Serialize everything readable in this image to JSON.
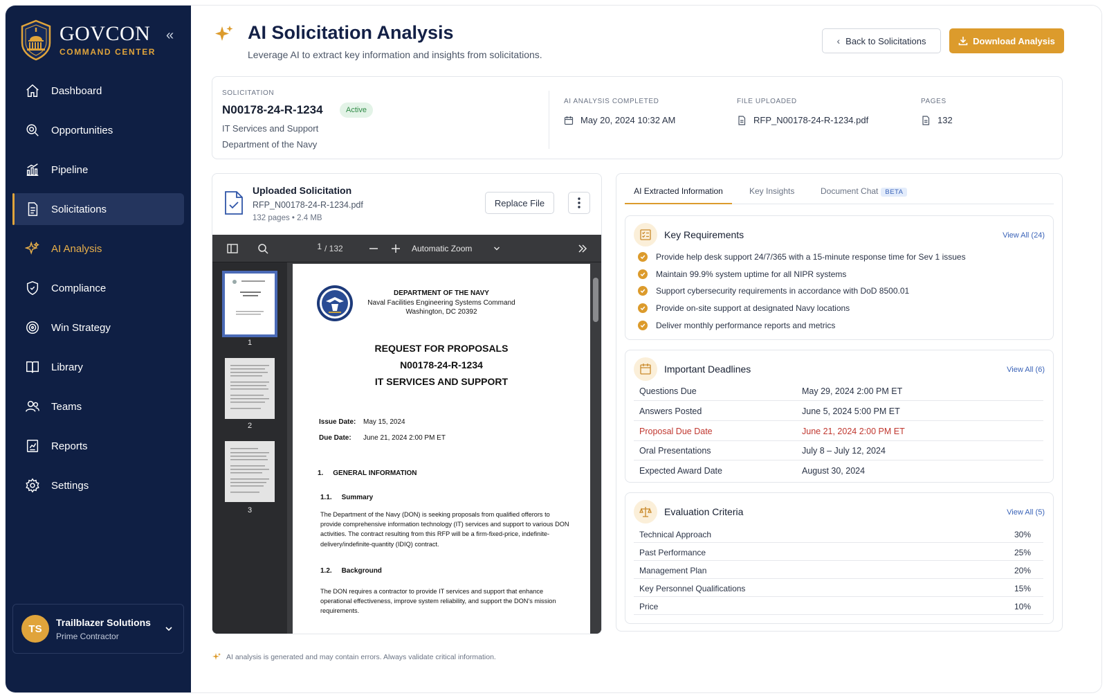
{
  "brand": {
    "name": "GOVCON",
    "tagline": "COMMAND CENTER"
  },
  "sidebar": {
    "items": [
      {
        "label": "Dashboard",
        "icon": "home-icon"
      },
      {
        "label": "Opportunities",
        "icon": "target-search-icon"
      },
      {
        "label": "Pipeline",
        "icon": "bar-chart-icon"
      },
      {
        "label": "Solicitations",
        "icon": "document-icon",
        "active": true
      },
      {
        "label": "AI Analysis",
        "icon": "sparkle-icon",
        "accent": true
      },
      {
        "label": "Compliance",
        "icon": "shield-icon"
      },
      {
        "label": "Win Strategy",
        "icon": "bullseye-icon"
      },
      {
        "label": "Library",
        "icon": "book-icon"
      },
      {
        "label": "Teams",
        "icon": "users-icon"
      },
      {
        "label": "Reports",
        "icon": "report-icon"
      },
      {
        "label": "Settings",
        "icon": "gear-icon"
      }
    ],
    "user": {
      "initials": "TS",
      "name": "Trailblazer Solutions",
      "role": "Prime Contractor"
    }
  },
  "header": {
    "title": "AI Solicitation Analysis",
    "subtitle": "Leverage AI to extract key information and insights from solicitations.",
    "back_label": "Back to Solicitations",
    "download_label": "Download Analysis"
  },
  "solicitation": {
    "label": "SOLICITATION",
    "number": "N00178-24-R-1234",
    "status": "Active",
    "title": "IT Services and Support",
    "agency": "Department of the Navy",
    "meta": [
      {
        "label": "AI ANALYSIS COMPLETED",
        "value": "May 20, 2024 10:32 AM",
        "icon": "calendar-icon"
      },
      {
        "label": "FILE UPLOADED",
        "value": "RFP_N00178-24-R-1234.pdf",
        "icon": "file-icon"
      },
      {
        "label": "PAGES",
        "value": "132",
        "icon": "file-icon"
      }
    ]
  },
  "upload": {
    "title": "Uploaded Solicitation",
    "filename": "RFP_N00178-24-R-1234.pdf",
    "meta": "132 pages • 2.4 MB",
    "replace_label": "Replace File"
  },
  "viewer": {
    "page": "1",
    "total": "/ 132",
    "zoom": "Automatic Zoom",
    "thumbs": [
      "1",
      "2",
      "3"
    ],
    "doc": {
      "dept": "DEPARTMENT OF THE NAVY",
      "command": "Naval Facilities Engineering Systems Command",
      "location": "Washington, DC 20392",
      "title1": "REQUEST FOR PROPOSALS",
      "title2": "N00178-24-R-1234",
      "title3": "IT SERVICES AND SUPPORT",
      "issue_label": "Issue Date:",
      "issue_value": "May 15, 2024",
      "due_label": "Due Date:",
      "due_value": "June 21, 2024 2:00 PM ET",
      "sec1": "1.     GENERAL INFORMATION",
      "sec11": "1.1.     Summary",
      "sec11_text": "The Department of the Navy (DON) is seeking proposals from qualified offerors to provide comprehensive information technology (IT) services and support to various DON activities. The contract resulting from this RFP will be a firm-fixed-price, indefinite-delivery/indefinite-quantity (IDIQ) contract.",
      "sec12": "1.2.     Background",
      "sec12_text": "The DON requires a contractor to provide IT services and support that enhance operational effectiveness, improve system reliability, and support the DON's mission requirements."
    }
  },
  "tabs": {
    "extracted": "AI Extracted Information",
    "insights": "Key Insights",
    "chat": "Document Chat",
    "beta": "BETA"
  },
  "requirements": {
    "title": "Key Requirements",
    "view_all": "View All (24)",
    "items": [
      "Provide help desk support 24/7/365 with a 15-minute response time for Sev 1 issues",
      "Maintain 99.9% system uptime for all NIPR systems",
      "Support cybersecurity requirements in accordance with DoD 8500.01",
      "Provide on-site support at designated Navy locations",
      "Deliver monthly performance reports and metrics"
    ]
  },
  "deadlines": {
    "title": "Important Deadlines",
    "view_all": "View All (6)",
    "rows": [
      {
        "label": "Questions Due",
        "value": "May 29, 2024 2:00 PM ET"
      },
      {
        "label": "Answers Posted",
        "value": "June 5, 2024 5:00 PM ET"
      },
      {
        "label": "Proposal Due Date",
        "value": "June 21, 2024 2:00 PM ET",
        "highlight": true
      },
      {
        "label": "Oral Presentations",
        "value": "July 8 – July 12, 2024"
      },
      {
        "label": "Expected Award Date",
        "value": "August 30, 2024"
      }
    ]
  },
  "evaluation": {
    "title": "Evaluation Criteria",
    "view_all": "View All (5)",
    "rows": [
      {
        "label": "Technical Approach",
        "value": "30%"
      },
      {
        "label": "Past Performance",
        "value": "25%"
      },
      {
        "label": "Management Plan",
        "value": "20%"
      },
      {
        "label": "Key Personnel Qualifications",
        "value": "15%"
      },
      {
        "label": "Price",
        "value": "10%"
      }
    ]
  },
  "disclaimer": "AI analysis is generated and may contain errors. Always validate critical information.",
  "colors": {
    "sidebar": "#0f1f44",
    "accent": "#dc9b2c",
    "active_item": "#24355e",
    "link": "#3a63b8",
    "danger": "#c0372f"
  }
}
